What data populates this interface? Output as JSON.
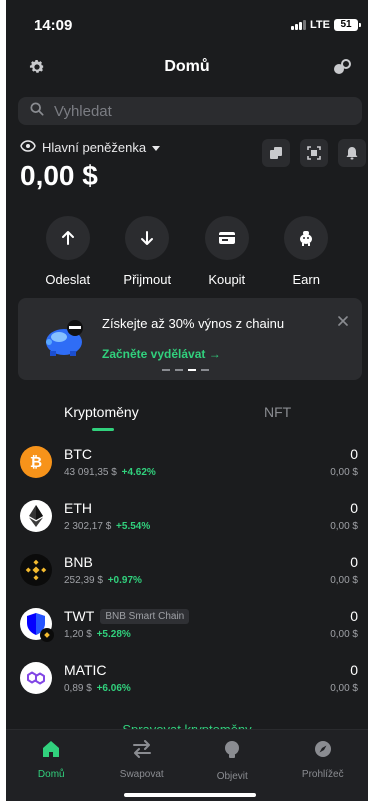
{
  "status_bar": {
    "time": "14:09",
    "network": "LTE",
    "battery": "51"
  },
  "header": {
    "title": "Domů"
  },
  "search": {
    "placeholder": "Vyhledat"
  },
  "wallet": {
    "name": "Hlavní peněženka",
    "balance": "0,00 $"
  },
  "actions": [
    {
      "label": "Odeslat",
      "icon": "arrow-up-icon"
    },
    {
      "label": "Přijmout",
      "icon": "arrow-down-icon"
    },
    {
      "label": "Koupit",
      "icon": "card-icon"
    },
    {
      "label": "Earn",
      "icon": "piggy-icon"
    }
  ],
  "promo": {
    "text": "Získejte až 30% výnos z chainu",
    "link": "Začněte vydělávat"
  },
  "tabs": {
    "crypto": "Kryptoměny",
    "nft": "NFT"
  },
  "assets": [
    {
      "symbol": "BTC",
      "price": "43 091,35 $",
      "change": "+4.62%",
      "amount": "0",
      "value": "0,00 $",
      "color": "#f7931a"
    },
    {
      "symbol": "ETH",
      "price": "2 302,17 $",
      "change": "+5.54%",
      "amount": "0",
      "value": "0,00 $",
      "color": "#ffffff"
    },
    {
      "symbol": "BNB",
      "price": "252,39 $",
      "change": "+0.97%",
      "amount": "0",
      "value": "0,00 $",
      "color": "#f3ba2f"
    },
    {
      "symbol": "TWT",
      "chain": "BNB Smart Chain",
      "price": "1,20 $",
      "change": "+5.28%",
      "amount": "0",
      "value": "0,00 $",
      "color": "#0500ff"
    },
    {
      "symbol": "MATIC",
      "price": "0,89 $",
      "change": "+6.06%",
      "amount": "0",
      "value": "0,00 $",
      "color": "#8247e5"
    }
  ],
  "manage_link": "Spravovat kryptoměny",
  "bottom_nav": [
    {
      "label": "Domů",
      "active": true
    },
    {
      "label": "Swapovat"
    },
    {
      "label": "Objevit"
    },
    {
      "label": "Prohlížeč"
    }
  ],
  "colors": {
    "accent": "#31d17d",
    "background": "#1b1c1e",
    "surface": "#2b2c2f"
  }
}
